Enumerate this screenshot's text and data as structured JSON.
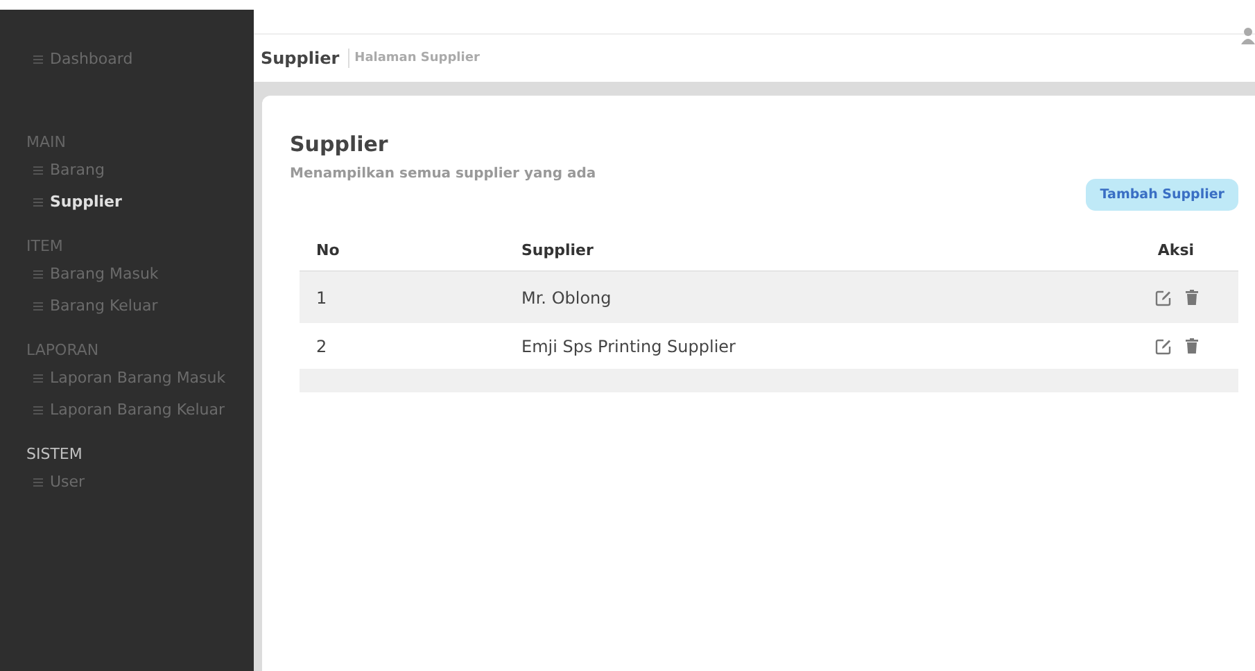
{
  "sidebar": {
    "top_item": {
      "label": "Dashboard",
      "selected": false
    },
    "sections": [
      {
        "title": "MAIN",
        "items": [
          {
            "label": "Barang",
            "selected": false
          },
          {
            "label": "Supplier",
            "selected": true
          }
        ]
      },
      {
        "title": "ITEM",
        "items": [
          {
            "label": "Barang Masuk",
            "selected": false
          },
          {
            "label": "Barang Keluar",
            "selected": false
          }
        ]
      },
      {
        "title": "LAPORAN",
        "items": [
          {
            "label": "Laporan Barang Masuk",
            "selected": false
          },
          {
            "label": "Laporan Barang Keluar",
            "selected": false
          }
        ]
      },
      {
        "title": "SISTEM",
        "items": [
          {
            "label": "User",
            "selected": false
          }
        ]
      }
    ]
  },
  "header": {
    "title": "Supplier",
    "subtitle": "Halaman Supplier"
  },
  "card": {
    "title": "Supplier",
    "description": "Menampilkan semua supplier yang ada",
    "add_button": "Tambah Supplier"
  },
  "table": {
    "columns": [
      "No",
      "Supplier",
      "Aksi"
    ],
    "rows": [
      {
        "no": "1",
        "supplier": "Mr. Oblong"
      },
      {
        "no": "2",
        "supplier": "Emji Sps Printing Supplier"
      }
    ]
  }
}
